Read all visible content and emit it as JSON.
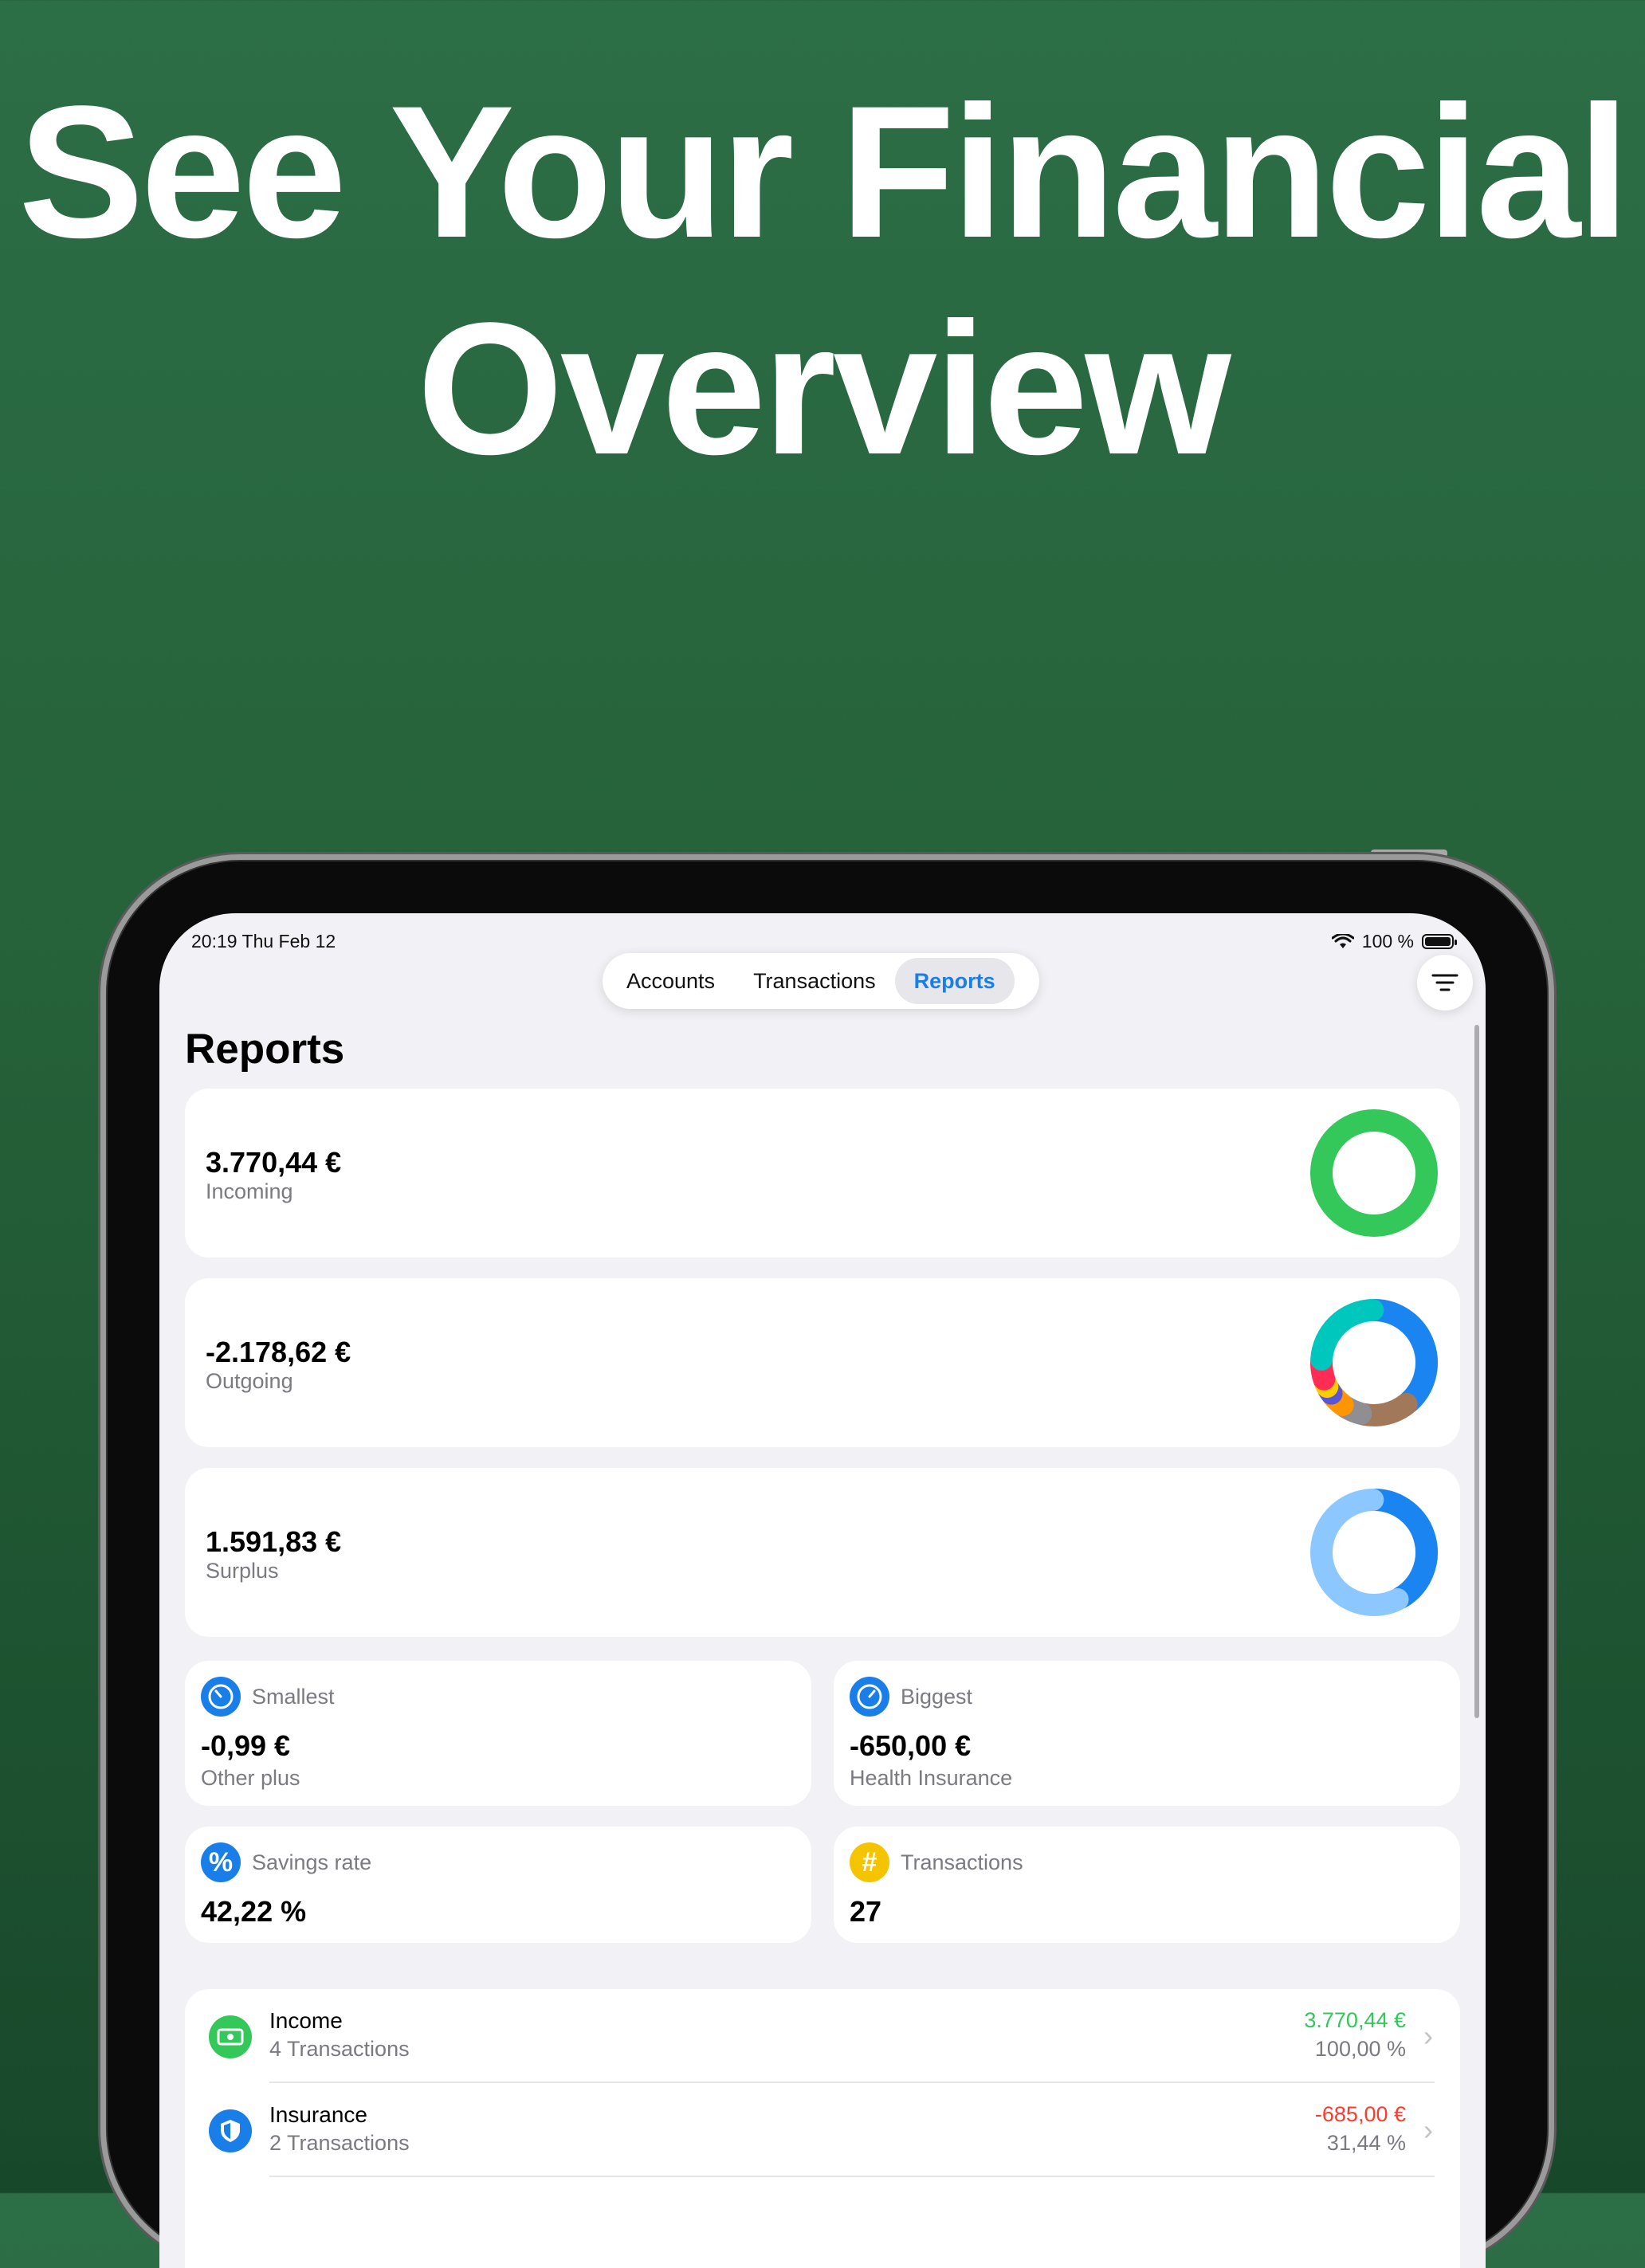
{
  "headline": {
    "line1": "See Your Financial",
    "line2": "Overview"
  },
  "status_bar": {
    "time": "20:19  Thu Feb 12",
    "battery": "100 %"
  },
  "tabs": [
    {
      "label": "Accounts",
      "active": false
    },
    {
      "label": "Transactions",
      "active": false
    },
    {
      "label": "Reports",
      "active": true
    }
  ],
  "page_title": "Reports",
  "summary_cards": [
    {
      "amount": "3.770,44 €",
      "label": "Incoming",
      "ring": "incoming-ring"
    },
    {
      "amount": "-2.178,62 €",
      "label": "Outgoing",
      "ring": "outgoing-ring"
    },
    {
      "amount": "1.591,83 €",
      "label": "Surplus",
      "ring": "surplus-ring"
    }
  ],
  "stats": {
    "smallest": {
      "caption": "Smallest",
      "value": "-0,99 €",
      "sub": "Other plus",
      "icon": "gauge-icon",
      "color": "#1a7ee8"
    },
    "biggest": {
      "caption": "Biggest",
      "value": "-650,00 €",
      "sub": "Health Insurance",
      "icon": "gauge-icon",
      "color": "#1a7ee8"
    },
    "savings": {
      "caption": "Savings rate",
      "value": "42,22 %",
      "icon": "percent-icon",
      "glyph": "%",
      "color": "#1a7ee8"
    },
    "transactions": {
      "caption": "Transactions",
      "value": "27",
      "icon": "hash-icon",
      "glyph": "#",
      "color": "#f5c400"
    }
  },
  "categories": [
    {
      "name": "Income",
      "count": "4 Transactions",
      "amount": "3.770,44 €",
      "percent": "100,00 %",
      "amount_color": "#34c759",
      "icon": "banknote-icon",
      "icon_color": "#34c759"
    },
    {
      "name": "Insurance",
      "count": "2 Transactions",
      "amount": "-685,00 €",
      "percent": "31,44 %",
      "amount_color": "#ff3b30",
      "icon": "shield-icon",
      "icon_color": "#1a7ee8"
    }
  ],
  "ring_charts": {
    "incoming": {
      "segments": [
        {
          "value": 100,
          "color": "#34c759"
        }
      ]
    },
    "outgoing": {
      "segments": [
        {
          "value": 32,
          "color": "#1a84f0"
        },
        {
          "value": 12,
          "color": "#a2785a"
        },
        {
          "value": 5,
          "color": "#8e8e93"
        },
        {
          "value": 4,
          "color": "#ff9500"
        },
        {
          "value": 2,
          "color": "#5856d6"
        },
        {
          "value": 2,
          "color": "#ffcc00"
        },
        {
          "value": 5,
          "color": "#ff2d55"
        },
        {
          "value": 20,
          "color": "#00c7be"
        }
      ]
    },
    "surplus": {
      "segments": [
        {
          "value": 42.22,
          "color": "#1a84f0"
        },
        {
          "value": 57.78,
          "color": "#8cc8ff"
        }
      ]
    }
  }
}
